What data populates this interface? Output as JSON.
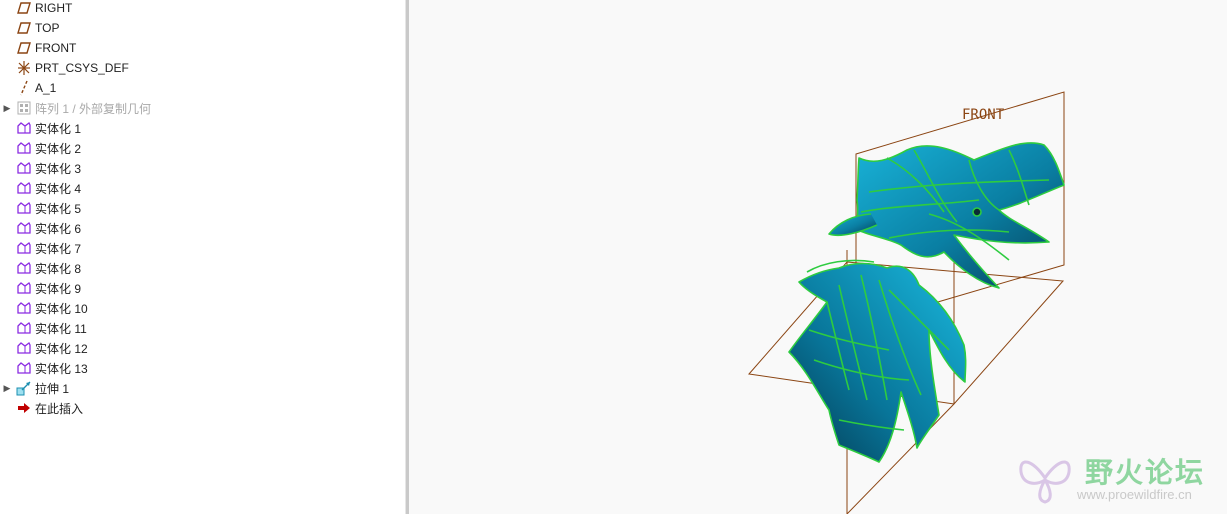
{
  "model_tree": {
    "items": [
      {
        "label": "RIGHT",
        "icon": "datum-plane-icon",
        "expandable": false,
        "dim": false
      },
      {
        "label": "TOP",
        "icon": "datum-plane-icon",
        "expandable": false,
        "dim": false
      },
      {
        "label": "FRONT",
        "icon": "datum-plane-icon",
        "expandable": false,
        "dim": false
      },
      {
        "label": "PRT_CSYS_DEF",
        "icon": "coordinate-system-icon",
        "expandable": false,
        "dim": false
      },
      {
        "label": "A_1",
        "icon": "datum-axis-icon",
        "expandable": false,
        "dim": false
      },
      {
        "label": "阵列 1 / 外部复制几何",
        "icon": "pattern-icon",
        "expandable": true,
        "dim": true
      },
      {
        "label": "实体化 1",
        "icon": "solidify-icon",
        "expandable": false,
        "dim": false
      },
      {
        "label": "实体化 2",
        "icon": "solidify-icon",
        "expandable": false,
        "dim": false
      },
      {
        "label": "实体化 3",
        "icon": "solidify-icon",
        "expandable": false,
        "dim": false
      },
      {
        "label": "实体化 4",
        "icon": "solidify-icon",
        "expandable": false,
        "dim": false
      },
      {
        "label": "实体化 5",
        "icon": "solidify-icon",
        "expandable": false,
        "dim": false
      },
      {
        "label": "实体化 6",
        "icon": "solidify-icon",
        "expandable": false,
        "dim": false
      },
      {
        "label": "实体化 7",
        "icon": "solidify-icon",
        "expandable": false,
        "dim": false
      },
      {
        "label": "实体化 8",
        "icon": "solidify-icon",
        "expandable": false,
        "dim": false
      },
      {
        "label": "实体化 9",
        "icon": "solidify-icon",
        "expandable": false,
        "dim": false
      },
      {
        "label": "实体化 10",
        "icon": "solidify-icon",
        "expandable": false,
        "dim": false
      },
      {
        "label": "实体化 11",
        "icon": "solidify-icon",
        "expandable": false,
        "dim": false
      },
      {
        "label": "实体化 12",
        "icon": "solidify-icon",
        "expandable": false,
        "dim": false
      },
      {
        "label": "实体化 13",
        "icon": "solidify-icon",
        "expandable": false,
        "dim": false
      },
      {
        "label": "拉伸 1",
        "icon": "extrude-icon",
        "expandable": true,
        "dim": false
      },
      {
        "label": "在此插入",
        "icon": "insert-here-arrow-icon",
        "expandable": false,
        "dim": false
      }
    ]
  },
  "viewport": {
    "datum_label": "FRONT",
    "surface_color": "#0e8fb5",
    "edge_color": "#2ecc40",
    "datum_color": "#8b4513"
  },
  "watermark": {
    "title": "野火论坛",
    "url": "www.proewildfire.cn"
  }
}
